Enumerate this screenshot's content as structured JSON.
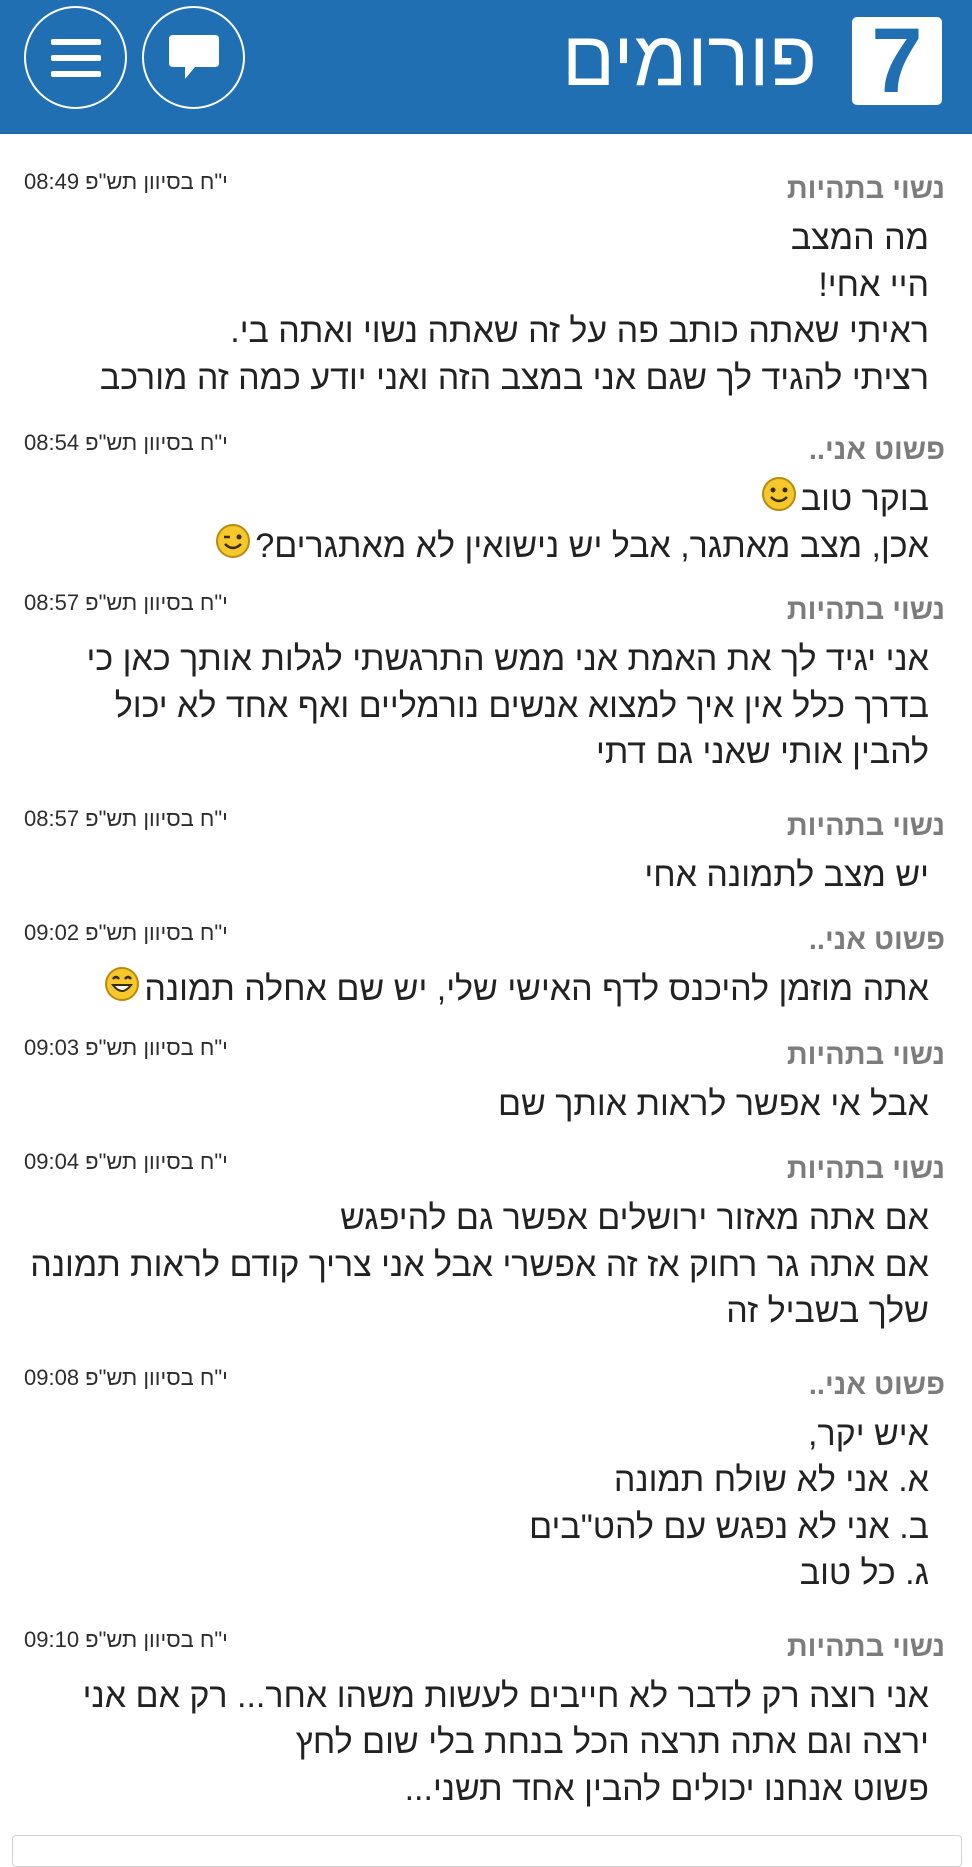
{
  "header": {
    "logo_number": "7",
    "site_title": "פורומים",
    "chat_icon": "chat-bubble-icon",
    "menu_icon": "hamburger-menu-icon",
    "background_color": "#1f6fb2"
  },
  "posts": [
    {
      "author": "נשוי בתהיות",
      "date": "י\"ח בסיוון תש\"פ 08:49",
      "lines": [
        "מה המצב",
        "היי אחי!",
        "ראיתי שאתה כותב פה על זה שאתה נשוי ואתה בי.",
        "רציתי להגיד לך שגם אני במצב הזה ואני יודע כמה זה מורכב"
      ]
    },
    {
      "author": "פשוט אני..",
      "date": "י\"ח בסיוון תש\"פ 08:54",
      "lines": [
        "בוקר טוב",
        "אכן, מצב מאתגר, אבל יש נישואין לא מאתגרים?"
      ],
      "emojis": [
        "smile-emoji-icon",
        "wink-emoji-icon"
      ]
    },
    {
      "author": "נשוי בתהיות",
      "date": "י\"ח בסיוון תש\"פ 08:57",
      "lines": [
        "אני יגיד לך את האמת אני ממש התרגשתי לגלות אותך כאן כי",
        "בדרך כלל אין איך למצוא אנשים נורמליים ואף אחד לא יכול",
        "להבין אותי שאני גם דתי"
      ]
    },
    {
      "author": "נשוי בתהיות",
      "date": "י\"ח בסיוון תש\"פ 08:57",
      "lines": [
        "יש מצב לתמונה אחי"
      ]
    },
    {
      "author": "פשוט אני..",
      "date": "י\"ח בסיוון תש\"פ 09:02",
      "lines": [
        "אתה מוזמן להיכנס לדף האישי שלי, יש שם אחלה תמונה"
      ],
      "emojis": [
        "grin-emoji-icon"
      ]
    },
    {
      "author": "נשוי בתהיות",
      "date": "י\"ח בסיוון תש\"פ 09:03",
      "lines": [
        "אבל אי אפשר לראות אותך שם"
      ]
    },
    {
      "author": "נשוי בתהיות",
      "date": "י\"ח בסיוון תש\"פ 09:04",
      "lines": [
        "אם אתה מאזור ירושלים אפשר גם להיפגש",
        "אם אתה גר רחוק אז זה אפשרי אבל אני צריך קודם לראות תמונה",
        "שלך בשביל זה"
      ]
    },
    {
      "author": "פשוט אני..",
      "date": "י\"ח בסיוון תש\"פ 09:08",
      "lines": [
        "איש יקר,",
        "א. אני לא שולח תמונה",
        "ב. אני לא נפגש עם להט\"בים",
        "ג. כל טוב"
      ]
    },
    {
      "author": "נשוי בתהיות",
      "date": "י\"ח בסיוון תש\"פ 09:10",
      "lines": [
        "אני רוצה רק לדבר לא חייבים לעשות משהו אחר... רק אם אני",
        "ירצה וגם אתה תרצה הכל בנחת בלי שום לחץ",
        "פשוט אנחנו יכולים להבין אחד תשני..."
      ]
    }
  ]
}
